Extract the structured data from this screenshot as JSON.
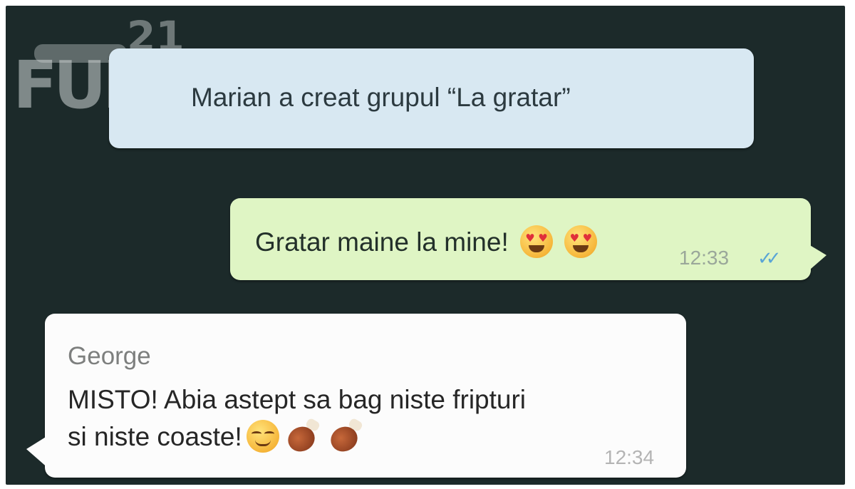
{
  "watermark": {
    "text": "FUN",
    "number": "21"
  },
  "system_message": {
    "text": "Marian a creat grupul “La gratar”"
  },
  "outgoing_message": {
    "text": "Gratar maine la mine!",
    "emojis": [
      "heart-eyes-emoji",
      "heart-eyes-emoji"
    ],
    "time": "12:33",
    "status_icon": "double-check-icon",
    "status_color": "#5aa5d6"
  },
  "incoming_message": {
    "sender": "George",
    "line1": "MISTO! Abia astept sa bag niste fripturi",
    "line2": "si niste coaste!",
    "emojis": [
      "relieved-smile-emoji",
      "meat-on-bone-emoji",
      "meat-on-bone-emoji"
    ],
    "time": "12:34"
  },
  "colors": {
    "chat_background": "#1c2a2a",
    "system_bubble": "#d8e8f2",
    "outgoing_bubble": "#dff5c4",
    "incoming_bubble": "#fcfcfc"
  }
}
